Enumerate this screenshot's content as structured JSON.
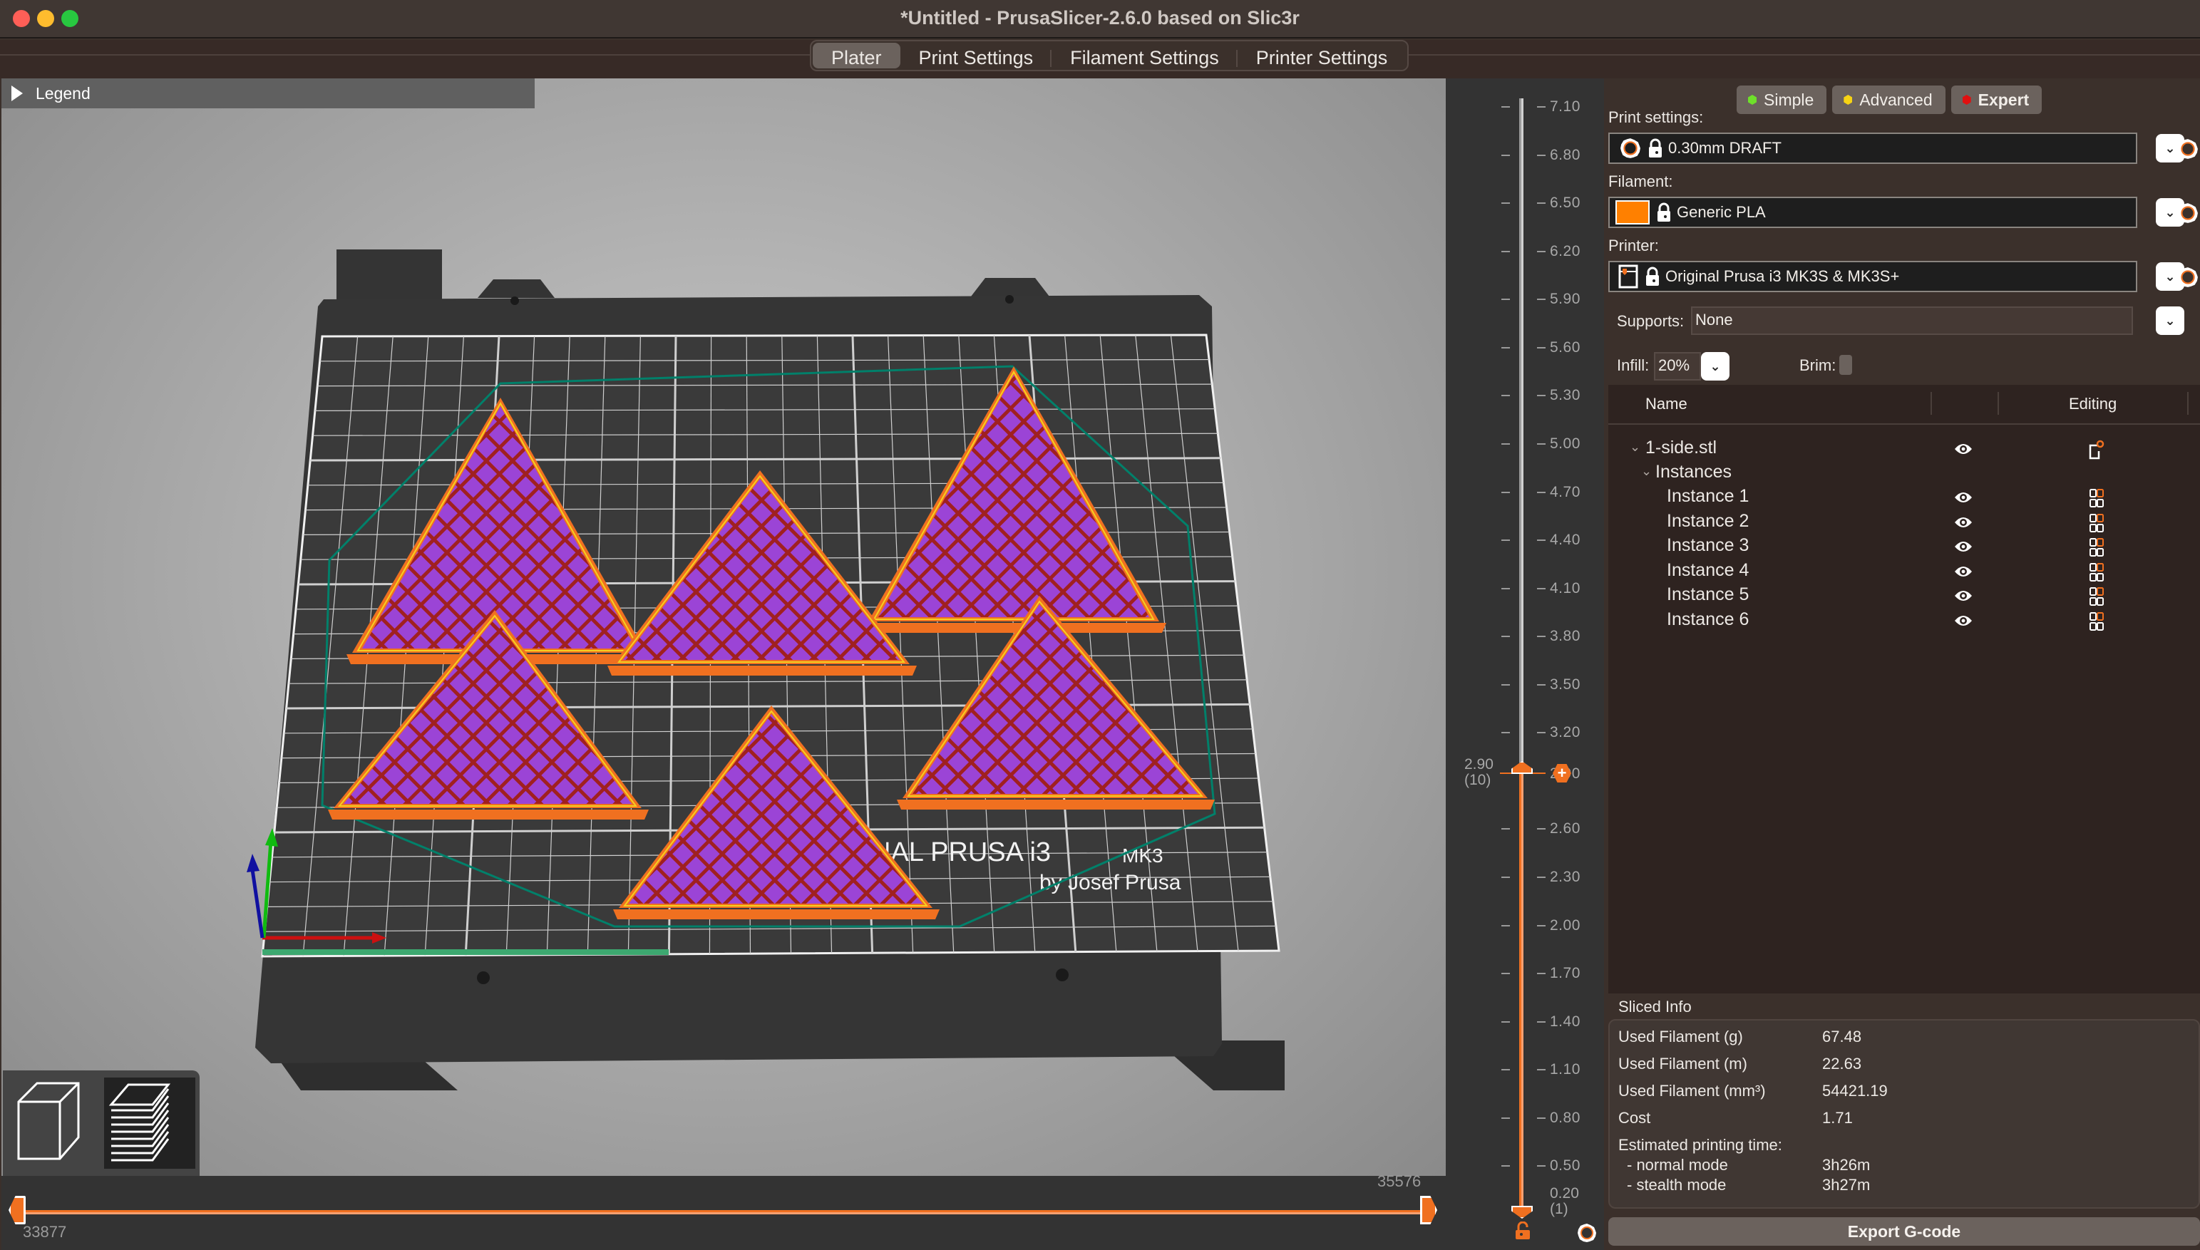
{
  "window": {
    "title": "*Untitled - PrusaSlicer-2.6.0 based on Slic3r",
    "traffic_lights": [
      "#ff5f57",
      "#febc2e",
      "#28c840"
    ]
  },
  "tabs": [
    {
      "label": "Plater",
      "active": true
    },
    {
      "label": "Print Settings",
      "active": false
    },
    {
      "label": "Filament Settings",
      "active": false
    },
    {
      "label": "Printer Settings",
      "active": false
    }
  ],
  "viewport": {
    "legend_label": "Legend",
    "bed_text_line1": "NAL PRUSA i3",
    "bed_text_mk": "MK3",
    "bed_text_line2": "by Josef Prusa",
    "view_modes": [
      {
        "name": "3d-view",
        "selected": false
      },
      {
        "name": "preview-layers",
        "selected": true
      }
    ],
    "colors": {
      "infill": "#9b44d6",
      "solid_infill": "#a02020",
      "perimeter": "#f07020",
      "external_perimeter": "#f5d020",
      "skirt": "#00806a",
      "bed": "#383838",
      "grid": "#e8e8e8"
    }
  },
  "horizontal_slider": {
    "min_label": "33877",
    "max_label": "35576"
  },
  "vertical_slider": {
    "ticks": [
      "7.10",
      "6.80",
      "6.50",
      "6.20",
      "5.90",
      "5.60",
      "5.30",
      "5.00",
      "4.70",
      "4.40",
      "4.10",
      "3.80",
      "3.50",
      "3.20",
      "2.90",
      "2.60",
      "2.30",
      "2.00",
      "1.70",
      "1.40",
      "1.10",
      "0.80",
      "0.50"
    ],
    "upper_value": "2.90",
    "upper_layer": "(10)",
    "lower_value": "0.20",
    "lower_layer": "(1)",
    "max_height": 7.1,
    "accent": "#f07020"
  },
  "sidebar": {
    "modes": [
      {
        "label": "Simple",
        "color": "#6ee02a",
        "bold": false
      },
      {
        "label": "Advanced",
        "color": "#f6d314",
        "bold": false
      },
      {
        "label": "Expert",
        "color": "#e01010",
        "bold": true
      }
    ],
    "print_settings": {
      "label": "Print settings:",
      "value": "0.30mm DRAFT"
    },
    "filament": {
      "label": "Filament:",
      "value": "Generic PLA",
      "swatch": "#ff8000"
    },
    "printer": {
      "label": "Printer:",
      "value": "Original Prusa i3 MK3S & MK3S+"
    },
    "supports": {
      "label": "Supports:",
      "value": "None"
    },
    "infill": {
      "label": "Infill:",
      "value": "20%"
    },
    "brim": {
      "label": "Brim:",
      "checked": false
    },
    "object_list": {
      "col_name": "Name",
      "col_editing": "Editing",
      "object": "1-side.stl",
      "instances_label": "Instances",
      "instances": [
        "Instance 1",
        "Instance 2",
        "Instance 3",
        "Instance 4",
        "Instance 5",
        "Instance 6"
      ]
    },
    "sliced_info": {
      "title": "Sliced Info",
      "rows": [
        {
          "label": "Used Filament (g)",
          "value": "67.48"
        },
        {
          "label": "Used Filament (m)",
          "value": "22.63"
        },
        {
          "label": "Used Filament (mm³)",
          "value": "54421.19"
        },
        {
          "label": "Cost",
          "value": "1.71"
        }
      ],
      "time_label": "Estimated printing time:",
      "times": [
        {
          "label": "- normal mode",
          "value": "3h26m"
        },
        {
          "label": "- stealth mode",
          "value": "3h27m"
        }
      ]
    },
    "export_label": "Export G-code"
  }
}
